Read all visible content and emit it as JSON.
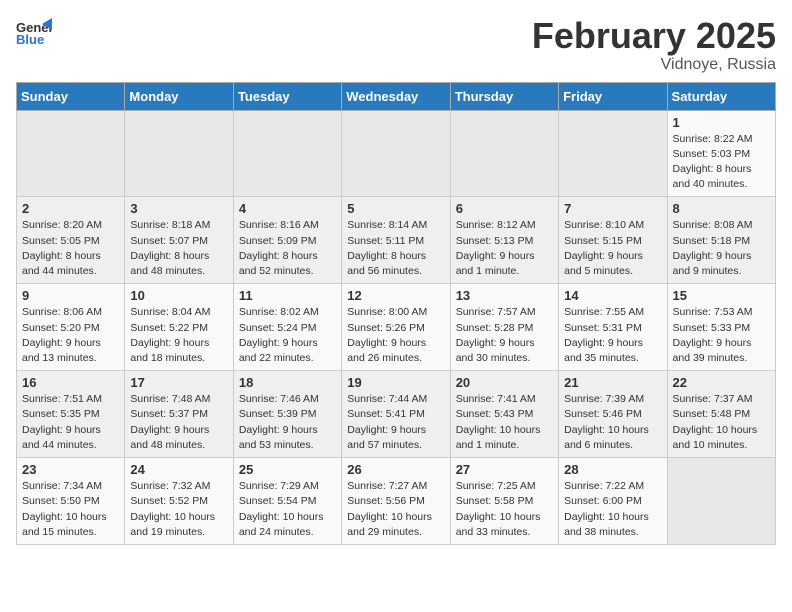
{
  "header": {
    "logo_general": "General",
    "logo_blue": "Blue",
    "title": "February 2025",
    "location": "Vidnoye, Russia"
  },
  "weekdays": [
    "Sunday",
    "Monday",
    "Tuesday",
    "Wednesday",
    "Thursday",
    "Friday",
    "Saturday"
  ],
  "weeks": [
    [
      {
        "day": "",
        "detail": ""
      },
      {
        "day": "",
        "detail": ""
      },
      {
        "day": "",
        "detail": ""
      },
      {
        "day": "",
        "detail": ""
      },
      {
        "day": "",
        "detail": ""
      },
      {
        "day": "",
        "detail": ""
      },
      {
        "day": "1",
        "detail": "Sunrise: 8:22 AM\nSunset: 5:03 PM\nDaylight: 8 hours and 40 minutes."
      }
    ],
    [
      {
        "day": "2",
        "detail": "Sunrise: 8:20 AM\nSunset: 5:05 PM\nDaylight: 8 hours and 44 minutes."
      },
      {
        "day": "3",
        "detail": "Sunrise: 8:18 AM\nSunset: 5:07 PM\nDaylight: 8 hours and 48 minutes."
      },
      {
        "day": "4",
        "detail": "Sunrise: 8:16 AM\nSunset: 5:09 PM\nDaylight: 8 hours and 52 minutes."
      },
      {
        "day": "5",
        "detail": "Sunrise: 8:14 AM\nSunset: 5:11 PM\nDaylight: 8 hours and 56 minutes."
      },
      {
        "day": "6",
        "detail": "Sunrise: 8:12 AM\nSunset: 5:13 PM\nDaylight: 9 hours and 1 minute."
      },
      {
        "day": "7",
        "detail": "Sunrise: 8:10 AM\nSunset: 5:15 PM\nDaylight: 9 hours and 5 minutes."
      },
      {
        "day": "8",
        "detail": "Sunrise: 8:08 AM\nSunset: 5:18 PM\nDaylight: 9 hours and 9 minutes."
      }
    ],
    [
      {
        "day": "9",
        "detail": "Sunrise: 8:06 AM\nSunset: 5:20 PM\nDaylight: 9 hours and 13 minutes."
      },
      {
        "day": "10",
        "detail": "Sunrise: 8:04 AM\nSunset: 5:22 PM\nDaylight: 9 hours and 18 minutes."
      },
      {
        "day": "11",
        "detail": "Sunrise: 8:02 AM\nSunset: 5:24 PM\nDaylight: 9 hours and 22 minutes."
      },
      {
        "day": "12",
        "detail": "Sunrise: 8:00 AM\nSunset: 5:26 PM\nDaylight: 9 hours and 26 minutes."
      },
      {
        "day": "13",
        "detail": "Sunrise: 7:57 AM\nSunset: 5:28 PM\nDaylight: 9 hours and 30 minutes."
      },
      {
        "day": "14",
        "detail": "Sunrise: 7:55 AM\nSunset: 5:31 PM\nDaylight: 9 hours and 35 minutes."
      },
      {
        "day": "15",
        "detail": "Sunrise: 7:53 AM\nSunset: 5:33 PM\nDaylight: 9 hours and 39 minutes."
      }
    ],
    [
      {
        "day": "16",
        "detail": "Sunrise: 7:51 AM\nSunset: 5:35 PM\nDaylight: 9 hours and 44 minutes."
      },
      {
        "day": "17",
        "detail": "Sunrise: 7:48 AM\nSunset: 5:37 PM\nDaylight: 9 hours and 48 minutes."
      },
      {
        "day": "18",
        "detail": "Sunrise: 7:46 AM\nSunset: 5:39 PM\nDaylight: 9 hours and 53 minutes."
      },
      {
        "day": "19",
        "detail": "Sunrise: 7:44 AM\nSunset: 5:41 PM\nDaylight: 9 hours and 57 minutes."
      },
      {
        "day": "20",
        "detail": "Sunrise: 7:41 AM\nSunset: 5:43 PM\nDaylight: 10 hours and 1 minute."
      },
      {
        "day": "21",
        "detail": "Sunrise: 7:39 AM\nSunset: 5:46 PM\nDaylight: 10 hours and 6 minutes."
      },
      {
        "day": "22",
        "detail": "Sunrise: 7:37 AM\nSunset: 5:48 PM\nDaylight: 10 hours and 10 minutes."
      }
    ],
    [
      {
        "day": "23",
        "detail": "Sunrise: 7:34 AM\nSunset: 5:50 PM\nDaylight: 10 hours and 15 minutes."
      },
      {
        "day": "24",
        "detail": "Sunrise: 7:32 AM\nSunset: 5:52 PM\nDaylight: 10 hours and 19 minutes."
      },
      {
        "day": "25",
        "detail": "Sunrise: 7:29 AM\nSunset: 5:54 PM\nDaylight: 10 hours and 24 minutes."
      },
      {
        "day": "26",
        "detail": "Sunrise: 7:27 AM\nSunset: 5:56 PM\nDaylight: 10 hours and 29 minutes."
      },
      {
        "day": "27",
        "detail": "Sunrise: 7:25 AM\nSunset: 5:58 PM\nDaylight: 10 hours and 33 minutes."
      },
      {
        "day": "28",
        "detail": "Sunrise: 7:22 AM\nSunset: 6:00 PM\nDaylight: 10 hours and 38 minutes."
      },
      {
        "day": "",
        "detail": ""
      }
    ]
  ]
}
